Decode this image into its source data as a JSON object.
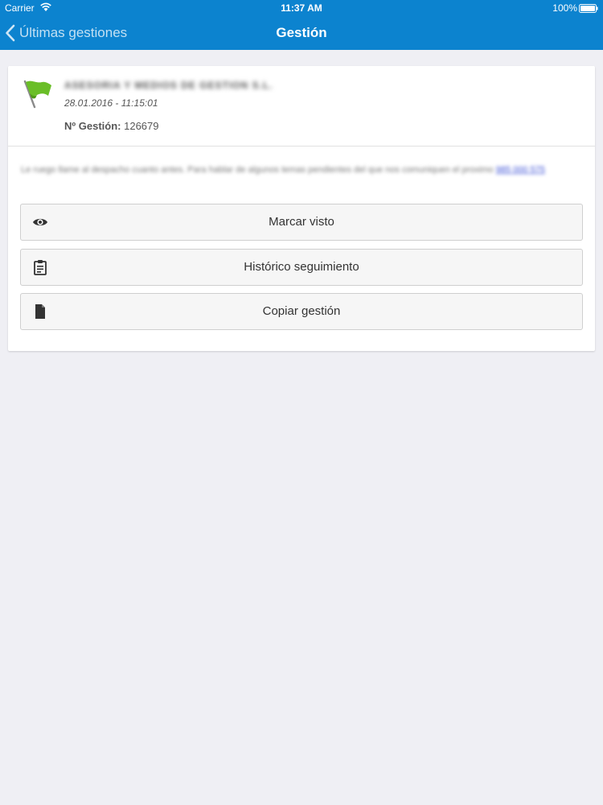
{
  "status_bar": {
    "carrier": "Carrier",
    "time": "11:37 AM",
    "battery": "100%"
  },
  "nav": {
    "back_label": "Últimas gestiones",
    "title": "Gestión"
  },
  "card": {
    "company_name": "ASESORIA Y MEDIOS DE GESTION S.L.",
    "datetime": "28.01.2016 - 11:15:01",
    "gestion_label": "Nº Gestión:",
    "gestion_number": "126679",
    "message_text": "Le ruego llame al despacho cuanto antes. Para hablar de algunos temas pendientes del que nos comuniquen el proximo",
    "message_phone": "985 000 575",
    "actions": [
      {
        "label": "Marcar visto",
        "icon": "eye-icon"
      },
      {
        "label": "Histórico seguimiento",
        "icon": "clipboard-icon"
      },
      {
        "label": "Copiar gestión",
        "icon": "document-icon"
      }
    ]
  },
  "colors": {
    "nav_bar": "#0c83cf",
    "background": "#efeff4",
    "flag": "#6abe28"
  }
}
